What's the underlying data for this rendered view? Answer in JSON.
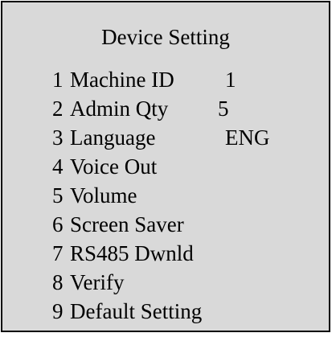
{
  "title": "Device Setting",
  "menu": {
    "items": [
      {
        "num": "1",
        "label": "Machine ID",
        "value": "1"
      },
      {
        "num": "2",
        "label": "Admin Qty",
        "value": "5"
      },
      {
        "num": "3",
        "label": "Language",
        "value": "ENG"
      },
      {
        "num": "4",
        "label": "Voice Out"
      },
      {
        "num": "5",
        "label": "Volume"
      },
      {
        "num": "6",
        "label": "Screen Saver"
      },
      {
        "num": "7",
        "label": "RS485 Dwnld"
      },
      {
        "num": "8",
        "label": "Verify"
      },
      {
        "num": "9",
        "label": "Default Setting"
      }
    ]
  },
  "colors": {
    "screen_background": "#d9d9d9",
    "border": "#000000",
    "text": "#000000"
  }
}
